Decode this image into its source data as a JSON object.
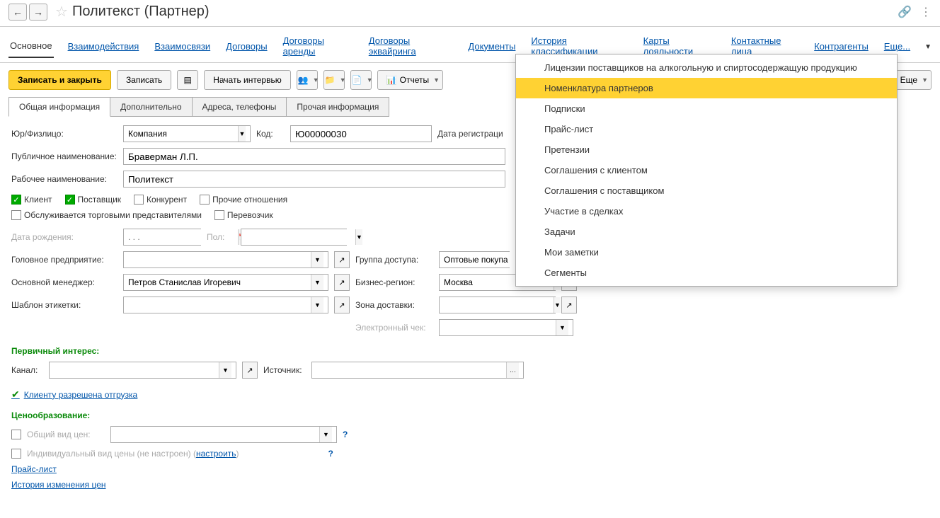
{
  "header": {
    "title": "Политекст (Партнер)"
  },
  "navtabs": [
    "Основное",
    "Взаимодействия",
    "Взаимосвязи",
    "Договоры",
    "Договоры аренды",
    "Договоры эквайринга",
    "Документы",
    "История классификации",
    "Карты лояльности",
    "Контактные лица",
    "Контрагенты",
    "Еще..."
  ],
  "toolbar": {
    "save_close": "Записать и закрыть",
    "save": "Записать",
    "interview": "Начать интервью",
    "reports": "Отчеты",
    "more": "Еще"
  },
  "subtabs": [
    "Общая информация",
    "Дополнительно",
    "Адреса, телефоны",
    "Прочая информация"
  ],
  "labels": {
    "ur_fiz": "Юр/Физлицо:",
    "code": "Код:",
    "reg_date": "Дата регистраци",
    "public_name": "Публичное наименование:",
    "work_name": "Рабочее наименование:",
    "client": "Клиент",
    "supplier": "Поставщик",
    "competitor": "Конкурент",
    "other_rel": "Прочие отношения",
    "served_by": "Обслуживается торговыми представителями",
    "carrier": "Перевозчик",
    "birthdate": "Дата рождения:",
    "gender": "Пол:",
    "head_company": "Головное предприятие:",
    "access_group": "Группа доступа:",
    "main_manager": "Основной менеджер:",
    "biz_region": "Бизнес-регион:",
    "label_template": "Шаблон этикетки:",
    "delivery_zone": "Зона доставки:",
    "echeck": "Электронный чек:",
    "primary_interest": "Первичный интерес:",
    "channel": "Канал:",
    "source": "Источник:",
    "ship_allowed": "Клиенту разрешена отгрузка",
    "pricing": "Ценообразование:",
    "common_price": "Общий вид цен:",
    "individual_price_pre": "Индивидуальный вид цены (не настроен) (",
    "configure": "настроить",
    "individual_price_post": ")",
    "price_list": "Прайс-лист",
    "price_history": "История изменения цен"
  },
  "values": {
    "company_type": "Компания",
    "code": "Ю00000030",
    "public_name": "Браверман Л.П.",
    "work_name": "Политекст",
    "access_group": "Оптовые покупа",
    "main_manager": "Петров Станислав Игоревич",
    "biz_region": "Москва",
    "birthdate_placeholder": ". . ."
  },
  "menu": {
    "items": [
      "Лицензии поставщиков на алкогольную и спиртосодержащую продукцию",
      "Номенклатура партнеров",
      "Подписки",
      "Прайс-лист",
      "Претензии",
      "Соглашения с клиентом",
      "Соглашения с поставщиком",
      "Участие в сделках",
      "Задачи",
      "Мои заметки",
      "Сегменты"
    ],
    "highlight_index": 1
  }
}
